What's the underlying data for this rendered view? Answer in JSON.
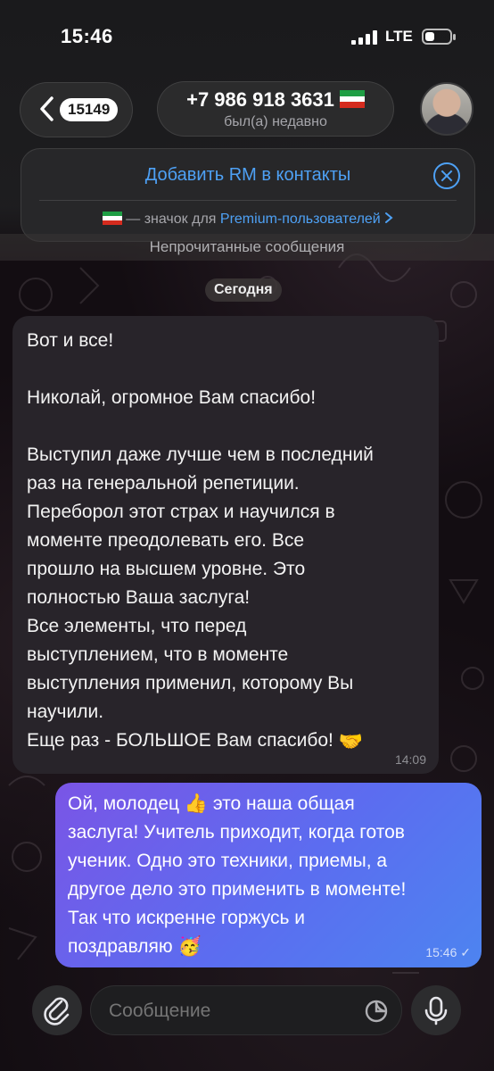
{
  "status_bar": {
    "time": "15:46",
    "network": "LTE",
    "icons": [
      "signal-bars-icon",
      "battery-icon"
    ]
  },
  "header": {
    "back_count": "15149",
    "title": "+7 986 918 3631",
    "subtitle": "был(а) недавно",
    "icons": [
      "chevron-left-icon",
      "flag-icon",
      "avatar"
    ]
  },
  "add_contact_panel": {
    "title": "Добавить RM в контакты",
    "note_prefix": "— значок для",
    "note_link": "Premium-пользователей",
    "icons": [
      "close-circle-icon",
      "flag-icon",
      "chevron-right-icon"
    ]
  },
  "unread_banner": "Непрочитанные сообщения",
  "date_chip": "Сегодня",
  "messages": [
    {
      "direction": "incoming",
      "text": "Вот и все!\n\nНиколай, огромное Вам спасибо!\n\nВыступил даже лучше чем в последний\nраз на генеральной репетиции.\nПереборол этот страх и научился в\nмоменте преодолевать его. Все\nпрошло на высшем уровне. Это\nполностью Ваша заслуга!\nВсе элементы, что перед\nвыступлением, что в моменте\nвыступления применил, которому Вы\nнаучили.\nЕще раз - БОЛЬШОЕ Вам спасибо!",
      "emoji": "🤝",
      "time": "14:09"
    },
    {
      "direction": "outgoing",
      "text_1": "Ой, молодец",
      "emoji_1": "👍",
      "text_2": " это наша общая\nзаслуга! Учитель приходит, когда готов\nученик. Одно это техники, приемы, а\nдругое дело это применить в моменте!\nТак что искренне горжусь и\nпоздравляю",
      "emoji_2": "🥳",
      "time": "15:46",
      "read_mark": "✓"
    }
  ],
  "input_bar": {
    "placeholder": "Сообщение",
    "icons": [
      "paperclip-icon",
      "sticker-icon",
      "microphone-icon"
    ]
  },
  "colors": {
    "accent_blue": "#4ea1f5",
    "outgoing_gradient_start": "#7a55e6",
    "outgoing_gradient_end": "#4d84f0",
    "incoming_bubble": "#28242a"
  }
}
